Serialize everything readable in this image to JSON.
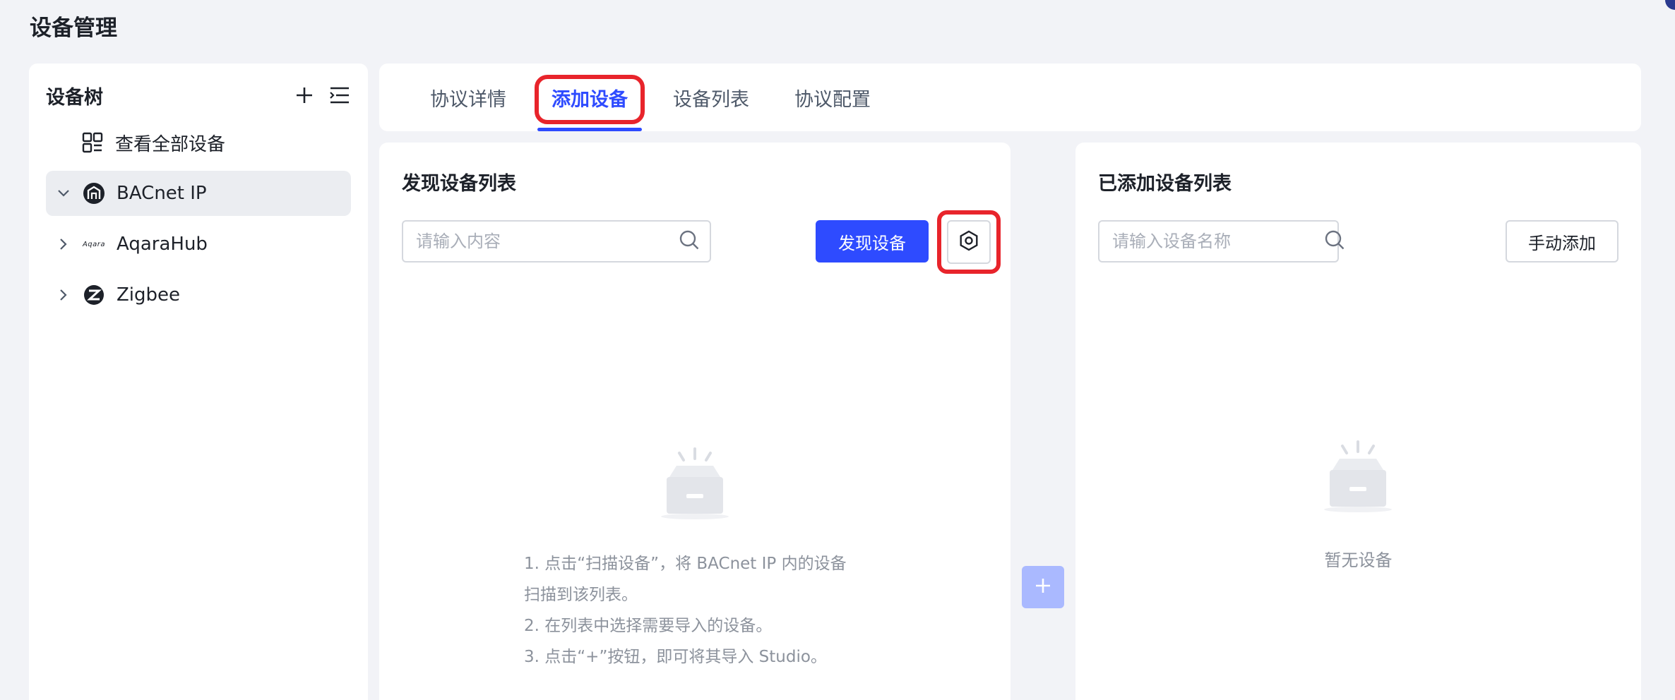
{
  "page": {
    "title": "设备管理"
  },
  "sidebar": {
    "title": "设备树",
    "view_all": "查看全部设备",
    "items": [
      {
        "label": "BACnet IP",
        "expanded": true,
        "active": true
      },
      {
        "label": "AqaraHub",
        "expanded": false,
        "active": false,
        "logo_text": "Aqara"
      },
      {
        "label": "Zigbee",
        "expanded": false,
        "active": false
      }
    ]
  },
  "tabs": [
    {
      "label": "协议详情",
      "active": false
    },
    {
      "label": "添加设备",
      "active": true
    },
    {
      "label": "设备列表",
      "active": false
    },
    {
      "label": "协议配置",
      "active": false
    }
  ],
  "discover": {
    "title": "发现设备列表",
    "search_placeholder": "请输入内容",
    "discover_button": "发现设备",
    "instructions": [
      "1. 点击“扫描设备”，将 BACnet IP 内的设备",
      "扫描到该列表。",
      "2. 在列表中选择需要导入的设备。",
      "3. 点击“+”按钮，即可将其导入 Studio。"
    ]
  },
  "added": {
    "title": "已添加设备列表",
    "search_placeholder": "请输入设备名称",
    "manual_add_button": "手动添加",
    "empty_text": "暂无设备"
  },
  "colors": {
    "accent": "#2e4bff",
    "highlight": "#e8242b",
    "transfer_disabled": "#aab9ff"
  }
}
